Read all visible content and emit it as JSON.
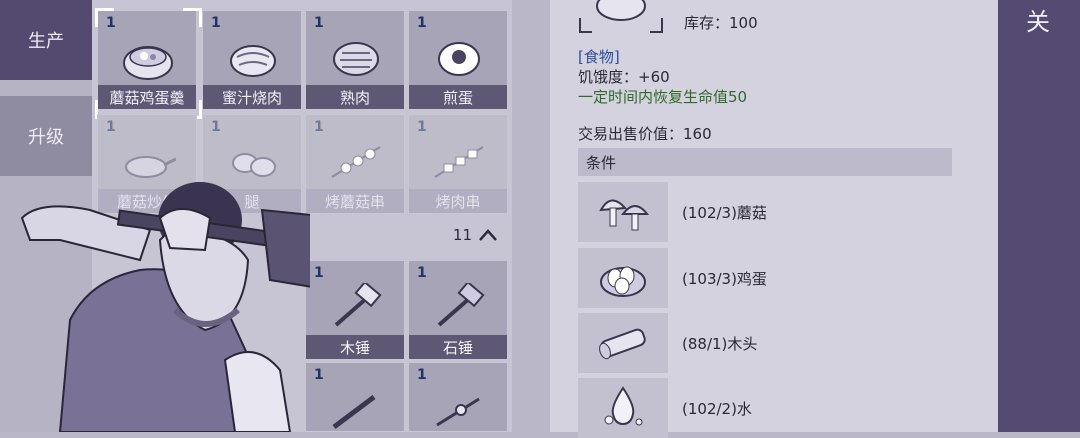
{
  "tabs": {
    "produce": "生产",
    "upgrade": "升级"
  },
  "grid": {
    "row1": [
      {
        "count": "1",
        "label": "蘑菇鸡蛋羹"
      },
      {
        "count": "1",
        "label": "蜜汁烧肉"
      },
      {
        "count": "1",
        "label": "熟肉"
      },
      {
        "count": "1",
        "label": "煎蛋"
      }
    ],
    "row2": [
      {
        "count": "1",
        "label": "蘑菇炒生"
      },
      {
        "count": "1",
        "label": "腿"
      },
      {
        "count": "1",
        "label": "烤蘑菇串"
      },
      {
        "count": "1",
        "label": "烤肉串"
      }
    ],
    "collapse_count": "11",
    "row3": [
      {
        "count": "1",
        "label": "木锤"
      },
      {
        "count": "1",
        "label": "石锤"
      }
    ],
    "row4": [
      {
        "count": "1"
      },
      {
        "count": "1"
      }
    ]
  },
  "detail": {
    "stock": "库存：100",
    "category": "[食物]",
    "hunger": "饥饿度：+60",
    "effect": "一定时间内恢复生命值50",
    "sell_value": "交易出售价值：160",
    "conditions_title": "条件",
    "requirements": [
      {
        "text": "(102/3)蘑菇",
        "icon": "mushroom-icon"
      },
      {
        "text": "(103/3)鸡蛋",
        "icon": "eggs-icon"
      },
      {
        "text": "(88/1)木头",
        "icon": "log-icon"
      },
      {
        "text": "(102/2)水",
        "icon": "water-icon"
      }
    ]
  },
  "close_label": "关",
  "colors": {
    "accent": "#544a70",
    "label_bg": "#5f5875",
    "effect_green": "#2f6a2a",
    "category_blue": "#2a4f9c"
  }
}
